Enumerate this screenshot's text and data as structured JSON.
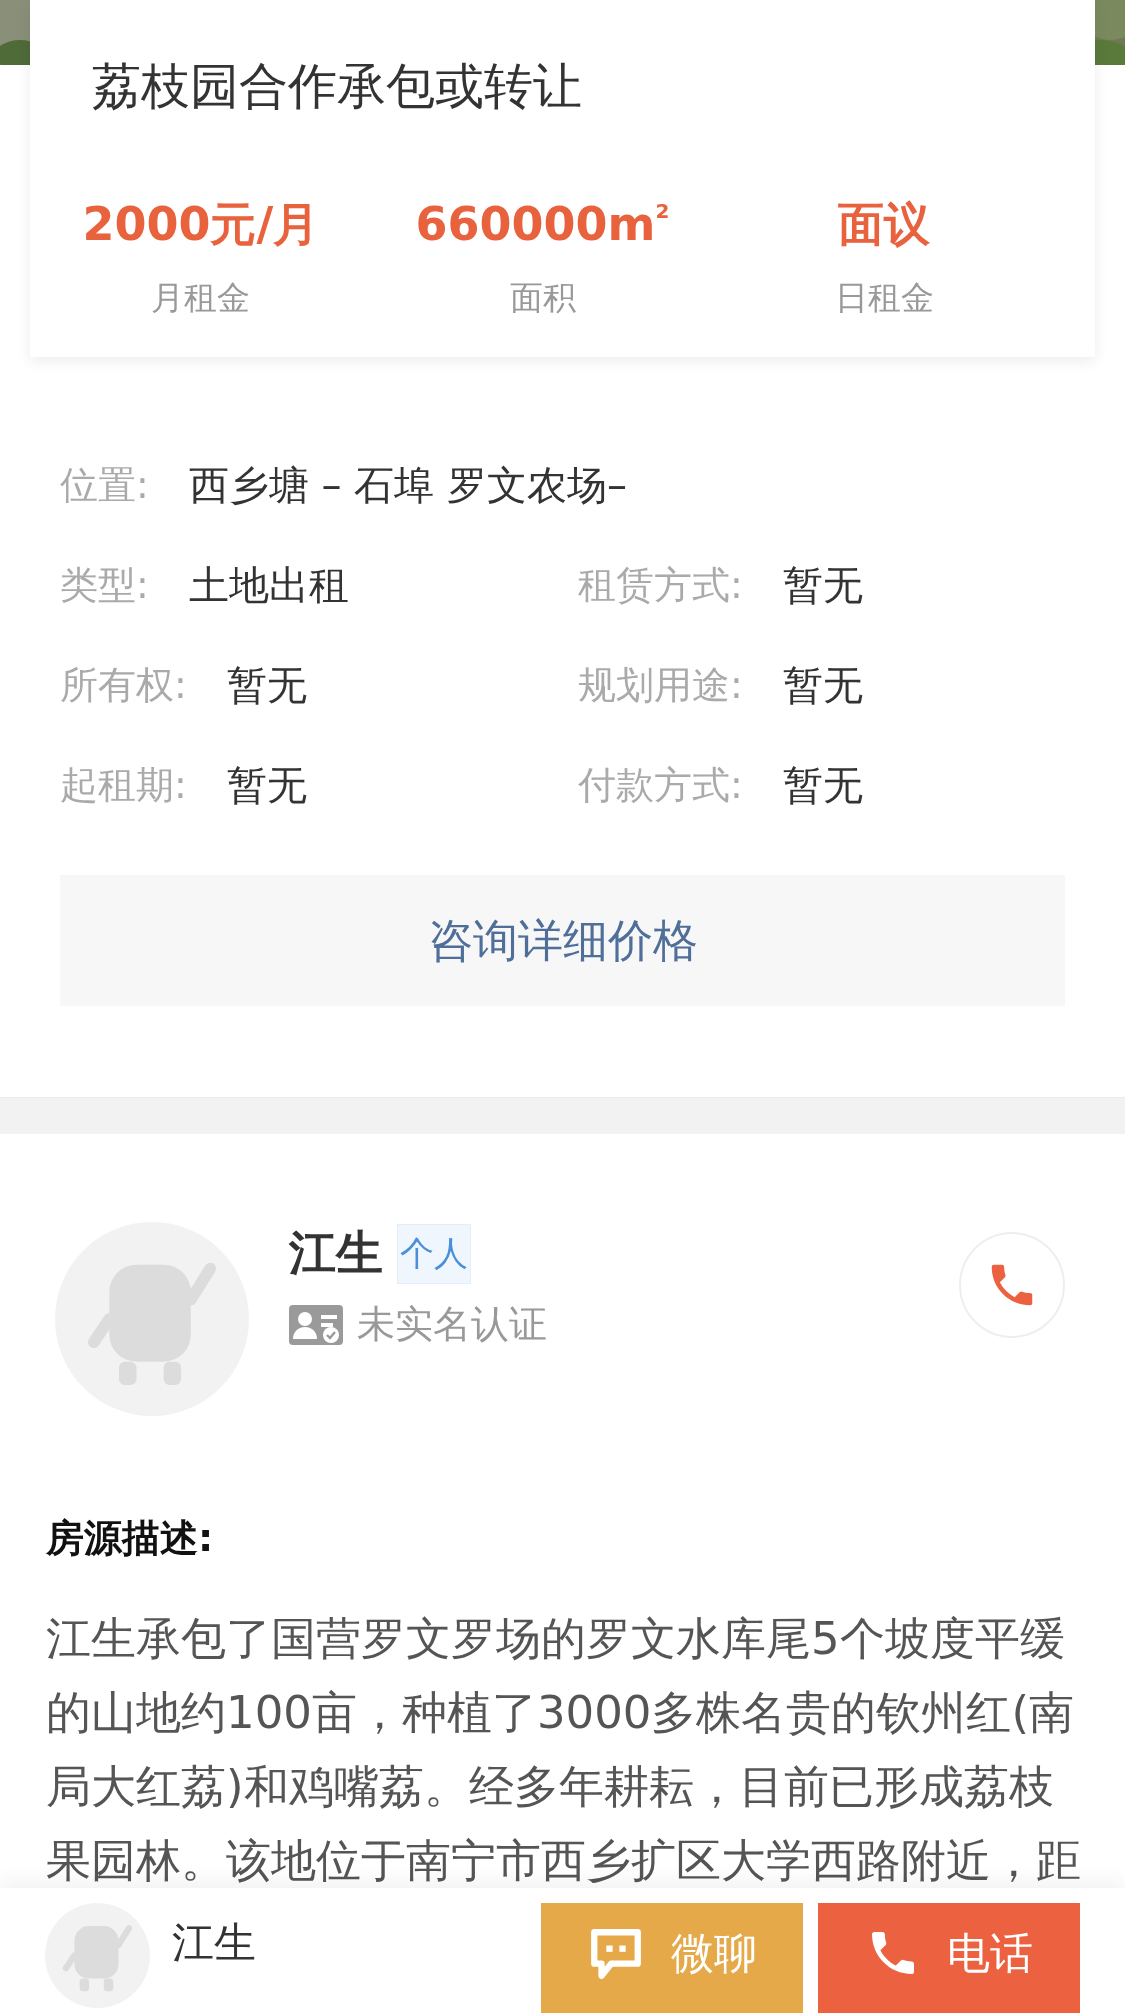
{
  "listing": {
    "title": "荔枝园合作承包或转让",
    "stats": [
      {
        "value": "2000元/月",
        "label": "月租金"
      },
      {
        "value": "660000m$^{2}$",
        "label": "面积"
      },
      {
        "value": "面议",
        "label": "日租金"
      }
    ]
  },
  "details": {
    "location": {
      "label": "位置:",
      "value": "西乡塘 – 石埠 罗文农场–"
    },
    "fields": [
      {
        "label": "类型:",
        "value": "土地出租"
      },
      {
        "label": "租赁方式:",
        "value": "暂无"
      },
      {
        "label": "所有权:",
        "value": "暂无"
      },
      {
        "label": "规划用途:",
        "value": "暂无"
      },
      {
        "label": "起租期:",
        "value": "暂无"
      },
      {
        "label": "付款方式:",
        "value": "暂无"
      }
    ]
  },
  "consult_button": "咨询详细价格",
  "seller": {
    "name": "江生",
    "tag": "个人",
    "verification": "未实名认证"
  },
  "description": {
    "heading": "房源描述:",
    "text": "江生承包了国营罗文罗场的罗文水库尾5个坡度平缓的山地约100亩，种植了3000多株名贵的钦州红(南局大红荔)和鸡嘴荔。经多年耕耘，目前已形成荔枝果园林。该地位于南宁市西乡扩区大学西路附近，距"
  },
  "bottom_bar": {
    "name": "江生",
    "buttons": [
      {
        "kind": "chat",
        "label": "微聊"
      },
      {
        "kind": "call",
        "label": "电话"
      }
    ]
  }
}
